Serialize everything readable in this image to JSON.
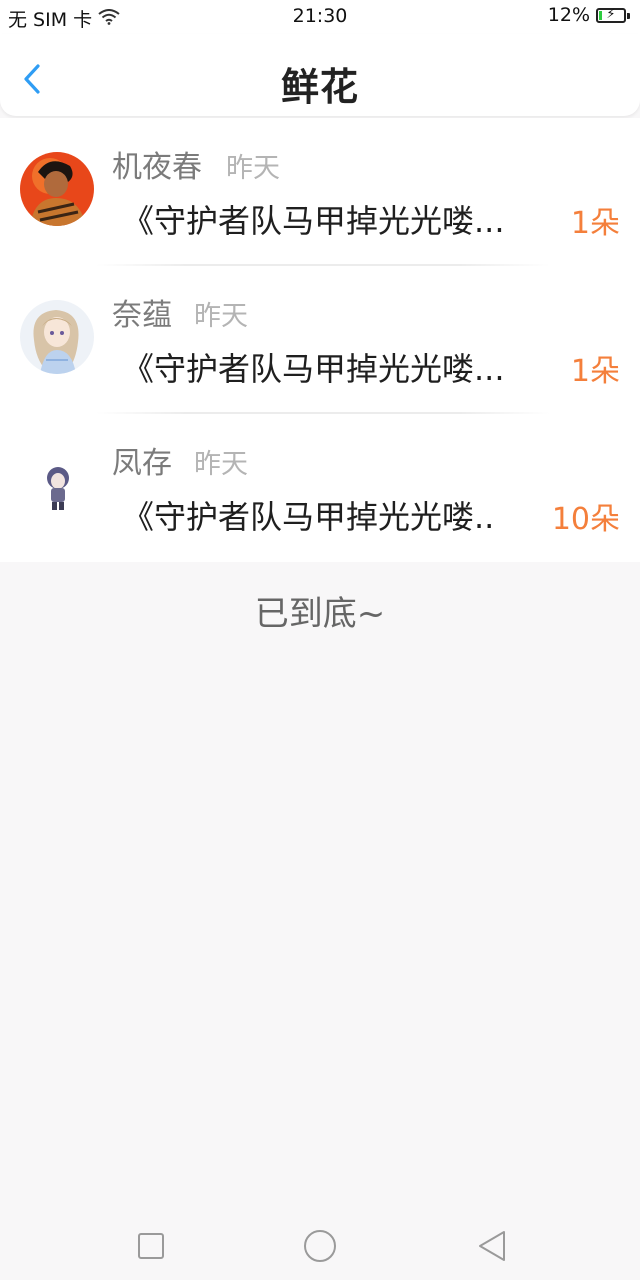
{
  "status_bar": {
    "carrier": "无 SIM 卡",
    "time": "21:30",
    "battery_percent": "12%",
    "battery_level": 0.12,
    "icons": [
      "wifi-icon",
      "battery-icon"
    ]
  },
  "header": {
    "title": "鲜花",
    "back_icon": "chevron-left-icon",
    "accent_color": "#2f9df4"
  },
  "items": [
    {
      "name": "机夜春",
      "time": "昨天",
      "title": "《守护者队马甲掉光光喽...",
      "count": "1朵"
    },
    {
      "name": "奈蕴",
      "time": "昨天",
      "title": "《守护者队马甲掉光光喽...",
      "count": "1朵"
    },
    {
      "name": "凤存",
      "time": "昨天",
      "title": "《守护者队马甲掉光光喽..",
      "count": "10朵"
    }
  ],
  "footer": {
    "end_text": "已到底~"
  },
  "nav": {
    "icons": [
      "recent-apps-icon",
      "home-icon",
      "back-icon"
    ]
  },
  "colors": {
    "count": "#f47f3b",
    "name": "#7b7b7b",
    "time": "#b4b4b4"
  }
}
